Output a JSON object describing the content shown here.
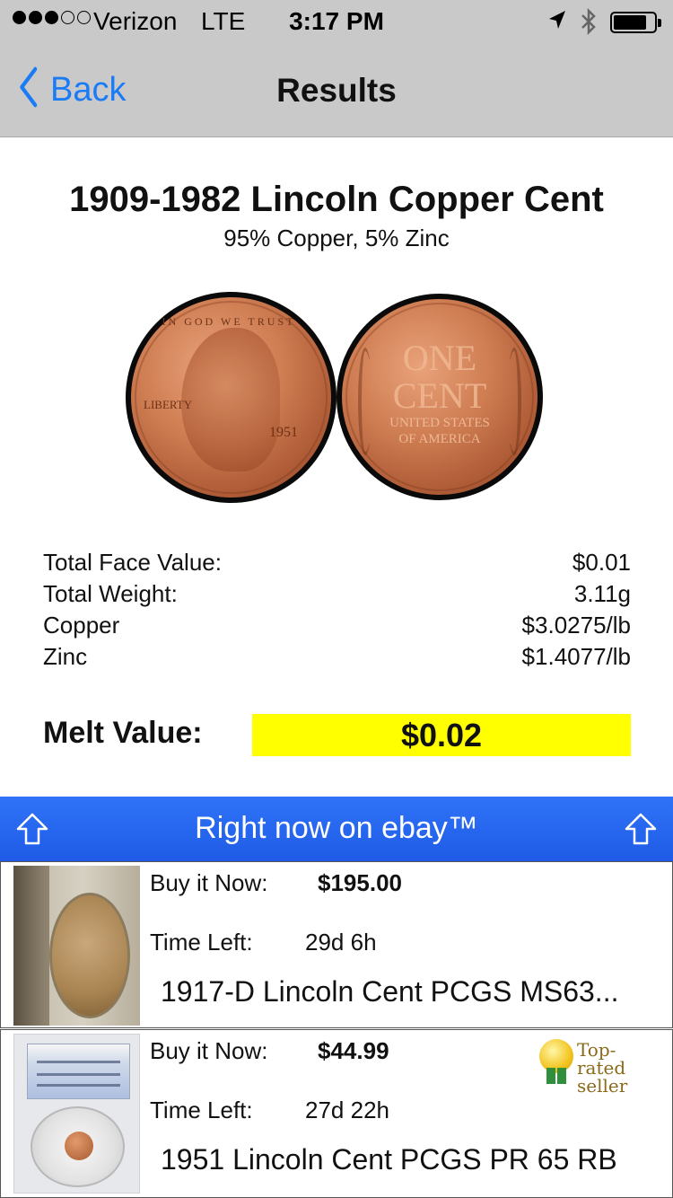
{
  "status_bar": {
    "carrier": "Verizon",
    "network": "LTE",
    "time": "3:17 PM",
    "signal_bars_filled": 3,
    "signal_bars_total": 5
  },
  "nav": {
    "back_label": "Back",
    "title": "Results"
  },
  "coin": {
    "title": "1909-1982 Lincoln Copper Cent",
    "composition": "95% Copper, 5% Zinc",
    "obverse": {
      "motto": "IN GOD WE TRUST",
      "liberty": "LIBERTY",
      "year": "1951"
    },
    "reverse": {
      "line1": "ONE",
      "line2": "CENT",
      "line3": "UNITED STATES",
      "line4": "OF AMERICA"
    }
  },
  "stats": [
    {
      "label": "Total Face Value:",
      "value": "$0.01"
    },
    {
      "label": "Total Weight:",
      "value": "3.11g"
    },
    {
      "label": "Copper",
      "value": "$3.0275/lb"
    },
    {
      "label": "Zinc",
      "value": "$1.4077/lb"
    }
  ],
  "melt": {
    "label": "Melt Value:",
    "value": "$0.02",
    "highlight_color": "#ffff00"
  },
  "ebay": {
    "title": "Right now on ebay™",
    "bar_color": "#2a6af3",
    "listings": [
      {
        "buy_label": "Buy it Now:",
        "price": "$195.00",
        "time_label": "Time Left:",
        "time_left": "29d 6h",
        "title": "1917-D Lincoln Cent PCGS MS63..."
      },
      {
        "buy_label": "Buy it Now:",
        "price": "$44.99",
        "time_label": "Time Left:",
        "time_left": "27d 22h",
        "title": "1951 Lincoln Cent PCGS PR 65 RB",
        "badge_line1": "Top-rated",
        "badge_line2": "seller"
      }
    ]
  },
  "icons": {
    "back": "chevron-left-icon",
    "location": "location-arrow-icon",
    "bluetooth": "bluetooth-icon",
    "battery": "battery-icon",
    "scroll_up": "up-arrow-icon",
    "badge": "top-rated-seller-badge-icon"
  }
}
